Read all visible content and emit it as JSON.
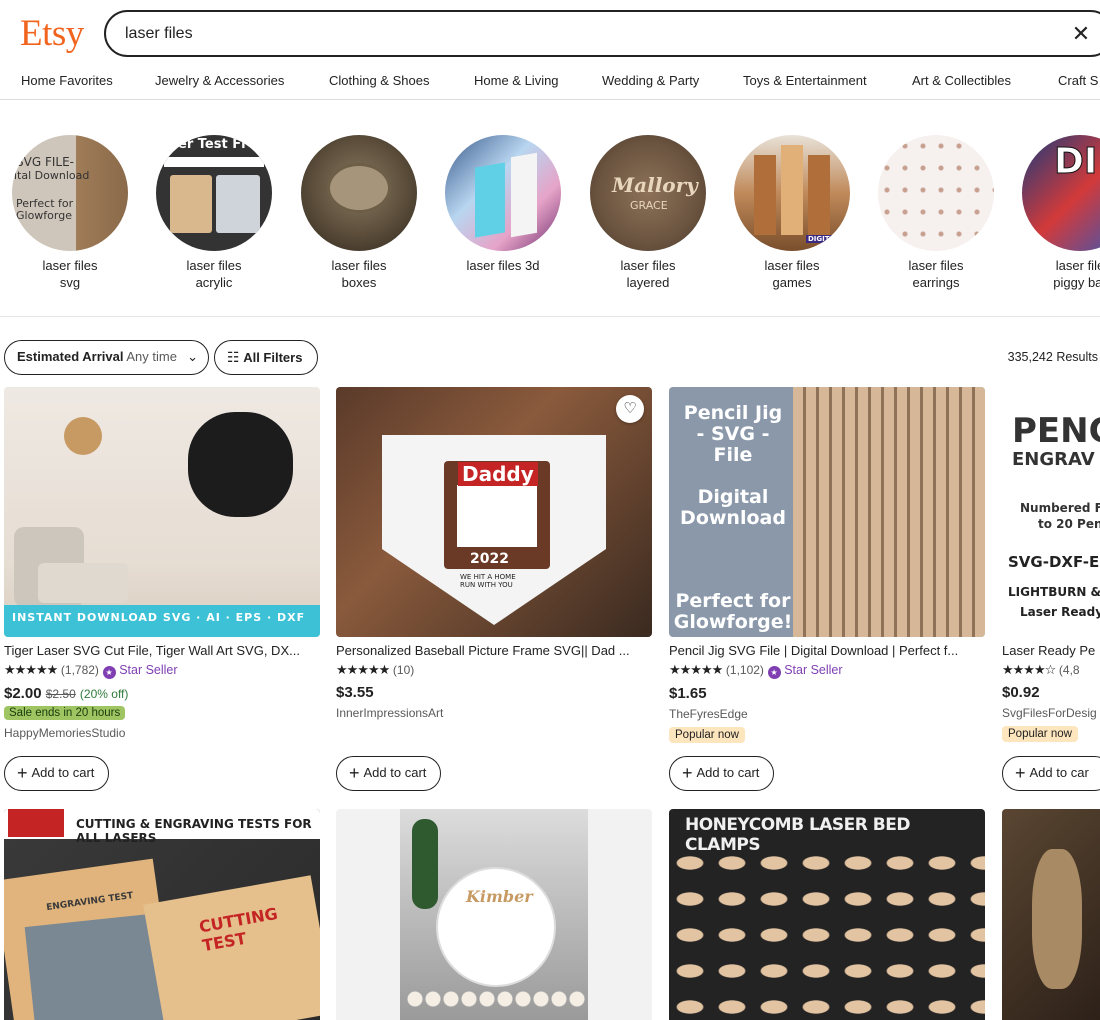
{
  "header": {
    "logo": "Etsy",
    "search_value": "laser files",
    "clear_icon": "close-icon"
  },
  "categories": [
    "Home Favorites",
    "Jewelry & Accessories",
    "Clothing & Shoes",
    "Home & Living",
    "Wedding & Party",
    "Toys & Entertainment",
    "Art & Collectibles",
    "Craft S"
  ],
  "related_searches": [
    {
      "line1": "laser files",
      "line2": "svg",
      "img_text1": "SVG FILE-",
      "img_text2": "ital Download",
      "img_text3": "Perfect for",
      "img_text4": "Glowforge"
    },
    {
      "line1": "laser files",
      "line2": "acrylic",
      "img_text1": "er Test Fi"
    },
    {
      "line1": "laser files",
      "line2": "boxes"
    },
    {
      "line1": "laser files 3d",
      "line2": ""
    },
    {
      "line1": "laser files",
      "line2": "layered",
      "img_text1": "Mallory",
      "img_text2": "GRACE"
    },
    {
      "line1": "laser files",
      "line2": "games",
      "img_text1": "DIGITAL"
    },
    {
      "line1": "laser files",
      "line2": "earrings"
    },
    {
      "line1": "laser file",
      "line2": "piggy bar",
      "img_text1": "DI"
    }
  ],
  "filters": {
    "arrival_label": "Estimated Arrival",
    "arrival_value": "Any time",
    "all_filters": "All Filters",
    "results": "335,242 Results"
  },
  "listings": [
    {
      "title": "Tiger Laser SVG Cut File, Tiger Wall Art SVG, DX...",
      "stars": "★★★★★",
      "count": "(1,782)",
      "star_seller": "Star Seller",
      "price": "$2.00",
      "old_price": "$2.50",
      "discount": "(20% off)",
      "sale": "Sale ends in 20 hours",
      "shop": "HappyMemoriesStudio",
      "cart": "Add to cart",
      "img_banner": "INSTANT DOWNLOAD  SVG · AI · EPS · DXF"
    },
    {
      "title": "Personalized Baseball Picture Frame SVG|| Dad ...",
      "stars": "★★★★★",
      "count": "(10)",
      "price": "$3.55",
      "shop": "InnerImpressionsArt",
      "cart": "Add to cart",
      "img_text1": "Daddy",
      "img_text2": "2022",
      "img_text3": "WE HIT A HOME RUN WITH YOU"
    },
    {
      "title": "Pencil Jig SVG File | Digital Download | Perfect f...",
      "stars": "★★★★★",
      "count": "(1,102)",
      "star_seller": "Star Seller",
      "price": "$1.65",
      "shop": "TheFyresEdge",
      "popular": "Popular now",
      "cart": "Add to cart",
      "img_text1": "Pencil Jig - SVG - File",
      "img_text2": "Digital Download",
      "img_text3": "Perfect for Glowforge!"
    },
    {
      "title": "Laser Ready Pe",
      "stars": "★★★★☆",
      "count": "(4,8",
      "price": "$0.92",
      "shop": "SvgFilesForDesig",
      "popular": "Popular now",
      "cart": "Add to car",
      "img_text1": "PENC",
      "img_text2": "ENGRAV",
      "img_text3": "Numbered Fo",
      "img_text4": "to 20 Penc",
      "img_text5": "SVG-DXF-EP",
      "img_text6": "LIGHTBURN & (",
      "img_text7": "Laser Ready"
    },
    {
      "img_text1": "CUTTING & ENGRAVING TESTS FOR ALL LASERS",
      "img_text2": "CUTTING TEST",
      "img_text3": "ENGRAVING TEST"
    },
    {
      "img_text1": "Kimber"
    },
    {
      "img_text1": "HONEYCOMB LASER BED CLAMPS"
    },
    {}
  ]
}
